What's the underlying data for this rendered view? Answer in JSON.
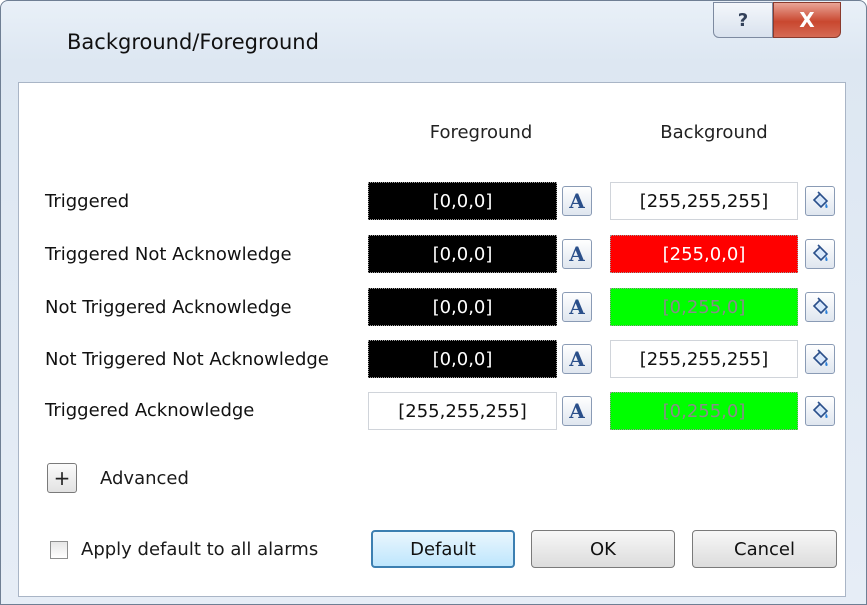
{
  "window": {
    "title": "Background/Foreground",
    "help_glyph": "?",
    "close_glyph": "X"
  },
  "columns": {
    "foreground": "Foreground",
    "background": "Background"
  },
  "rows": [
    {
      "label": "Triggered",
      "fg": "[0,0,0]",
      "bg": "[255,255,255]"
    },
    {
      "label": "Triggered Not Acknowledge",
      "fg": "[0,0,0]",
      "bg": "[255,0,0]"
    },
    {
      "label": "Not Triggered Acknowledge",
      "fg": "[0,0,0]",
      "bg": "[0,255,0]"
    },
    {
      "label": "Not Triggered Not Acknowledge",
      "fg": "[0,0,0]",
      "bg": "[255,255,255]"
    },
    {
      "label": "Triggered Acknowledge",
      "fg": "[255,255,255]",
      "bg": "[0,255,0]"
    }
  ],
  "icons": {
    "font_color": "font-color-icon",
    "fill_color": "paint-bucket-icon"
  },
  "font_glyph": "A",
  "advanced": {
    "toggle": "+",
    "label": "Advanced"
  },
  "apply_default": {
    "label": "Apply default to all alarms",
    "checked": false
  },
  "buttons": {
    "default": "Default",
    "ok": "OK",
    "cancel": "Cancel"
  },
  "colors": {
    "black": "#000000",
    "white": "#ffffff",
    "red": "#ff0000",
    "green": "#00ff00",
    "default_button_border": "#3c7fb1"
  }
}
